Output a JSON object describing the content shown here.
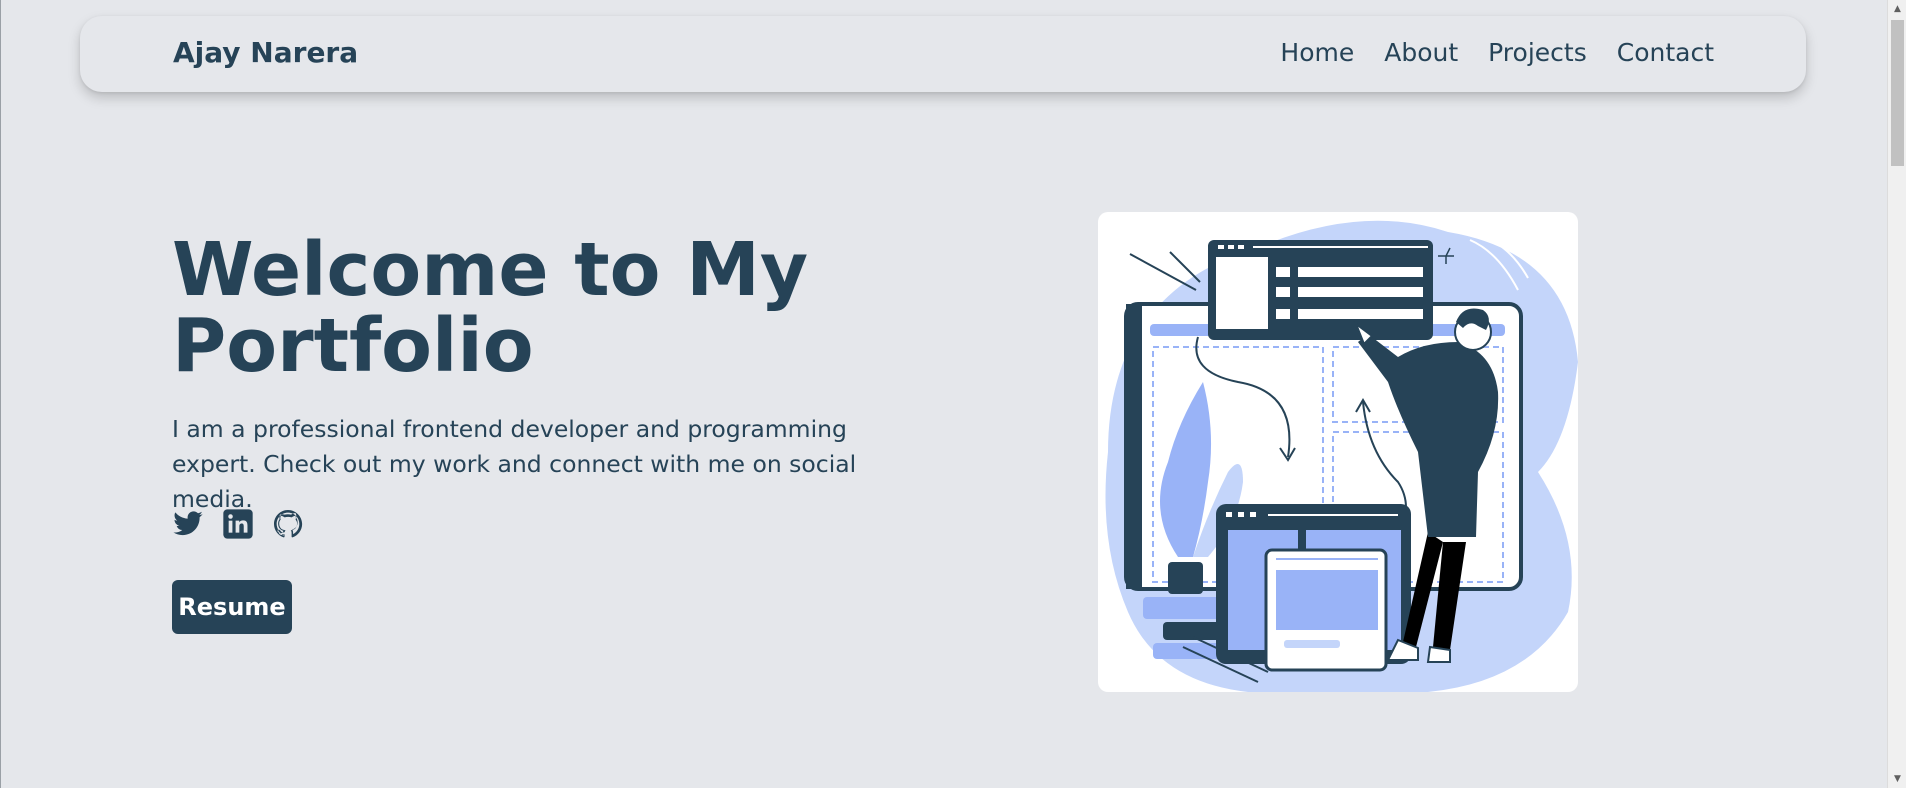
{
  "navbar": {
    "brand": "Ajay Narera",
    "links": [
      "Home",
      "About",
      "Projects",
      "Contact"
    ]
  },
  "hero": {
    "title": "Welcome to My Portfolio",
    "description": "I am a professional frontend developer and programming expert. Check out my work and connect with me on social media.",
    "social": [
      "twitter-icon",
      "linkedin-icon",
      "github-icon"
    ],
    "resume_label": "Resume"
  },
  "colors": {
    "background": "#e5e7eb",
    "primary": "#264357",
    "illustration_accent": "#99b3f7",
    "illustration_blob": "#c4d5fa"
  }
}
